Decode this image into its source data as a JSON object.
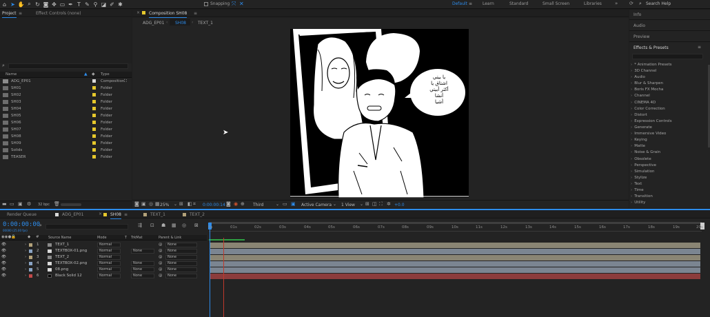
{
  "toolbar": {
    "snapping_label": "Snapping",
    "workspaces": [
      "Default",
      "Learn",
      "Standard",
      "Small Screen",
      "Libraries"
    ],
    "search_help": "Search Help",
    "accent": "#2d8ceb"
  },
  "left_panel": {
    "tab_project": "Project",
    "tab_effect_controls": "Effect Controls (none)",
    "col_name": "Name",
    "col_type": "Type",
    "items": [
      {
        "name": "ADG_EP01",
        "type": "Composition"
      },
      {
        "name": "SH01",
        "type": "Folder"
      },
      {
        "name": "SH02",
        "type": "Folder"
      },
      {
        "name": "SH03",
        "type": "Folder"
      },
      {
        "name": "SH04",
        "type": "Folder"
      },
      {
        "name": "SH05",
        "type": "Folder"
      },
      {
        "name": "SH06",
        "type": "Folder"
      },
      {
        "name": "SH07",
        "type": "Folder"
      },
      {
        "name": "SH08",
        "type": "Folder"
      },
      {
        "name": "SH09",
        "type": "Folder"
      },
      {
        "name": "Solids",
        "type": "Folder"
      },
      {
        "name": "TEASER",
        "type": "Folder"
      }
    ],
    "bpc": "32 bpc"
  },
  "comp_panel": {
    "title": "Composition SH08",
    "breadcrumbs": [
      "ADG_EP01",
      "SH08",
      "TEXT_1"
    ],
    "zoom": "25%",
    "timecode": "0:00:00:14",
    "resolution": "Third",
    "camera": "Active Camera",
    "view": "1 View",
    "exposure": "+0.0",
    "speech_text": "يا بيتي\nاشتاق يا\nأكثر أبيتي\nأنشا\nأشيا"
  },
  "right_panel": {
    "info": "Info",
    "audio": "Audio",
    "preview": "Preview",
    "effects_title": "Effects & Presets",
    "effects": [
      "* Animation Presets",
      "3D Channel",
      "Audio",
      "Blur & Sharpen",
      "Boris FX Mocha",
      "Channel",
      "CINEMA 4D",
      "Color Correction",
      "Distort",
      "Expression Controls",
      "Generate",
      "Immersive Video",
      "Keying",
      "Matte",
      "Noise & Grain",
      "Obsolete",
      "Perspective",
      "Simulation",
      "Stylize",
      "Text",
      "Time",
      "Transition",
      "Utility"
    ]
  },
  "timeline": {
    "tabs": [
      "Render Queue",
      "ADG_EP01",
      "SH08",
      "TEXT_1",
      "TEXT_2"
    ],
    "timecode": "0:00:00:00",
    "fps": "00000 (25.00 fps)",
    "col_source": "Source Name",
    "col_mode": "Mode",
    "col_trkmat": "TrkMat",
    "col_parent": "Parent & Link",
    "ruler": [
      "0s",
      "01s",
      "02s",
      "03s",
      "04s",
      "05s",
      "06s",
      "07s",
      "08s",
      "09s",
      "10s",
      "11s",
      "12s",
      "13s",
      "14s",
      "15s",
      "16s",
      "17s",
      "18s",
      "19s",
      "20s"
    ],
    "layers": [
      {
        "num": "1",
        "name": "TEXT_1",
        "mode": "Normal",
        "trkmat": "",
        "parent": "None",
        "color": "#b3a27a",
        "bar": "#8a8574"
      },
      {
        "num": "2",
        "name": "TEXTBOX-01.png",
        "mode": "Normal",
        "trkmat": "None",
        "parent": "None",
        "color": "#8aa4c4",
        "bar": "#7b8591"
      },
      {
        "num": "3",
        "name": "TEXT_2",
        "mode": "Normal",
        "trkmat": "",
        "parent": "None",
        "color": "#b3a27a",
        "bar": "#8a8574"
      },
      {
        "num": "4",
        "name": "TEXTBOX-02.png",
        "mode": "Normal",
        "trkmat": "None",
        "parent": "None",
        "color": "#8aa4c4",
        "bar": "#7b8591"
      },
      {
        "num": "5",
        "name": "08.png",
        "mode": "Normal",
        "trkmat": "None",
        "parent": "None",
        "color": "#8aa4c4",
        "bar": "#7b8591"
      },
      {
        "num": "6",
        "name": "Black Solid 12",
        "mode": "Normal",
        "trkmat": "None",
        "parent": "None",
        "color": "#c24a4a",
        "bar": "#8c3c3c"
      }
    ]
  }
}
